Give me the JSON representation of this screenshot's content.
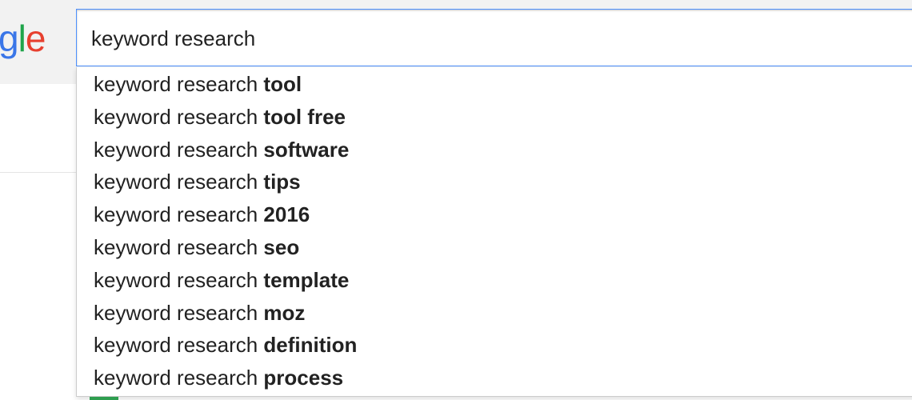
{
  "logo": {
    "letters": [
      "g",
      "l",
      "e"
    ]
  },
  "search": {
    "query": "keyword research"
  },
  "suggestions": [
    {
      "prefix": "keyword research ",
      "completion": "tool"
    },
    {
      "prefix": "keyword research ",
      "completion": "tool free"
    },
    {
      "prefix": "keyword research ",
      "completion": "software"
    },
    {
      "prefix": "keyword research ",
      "completion": "tips"
    },
    {
      "prefix": "keyword research ",
      "completion": "2016"
    },
    {
      "prefix": "keyword research ",
      "completion": "seo"
    },
    {
      "prefix": "keyword research ",
      "completion": "template"
    },
    {
      "prefix": "keyword research ",
      "completion": "moz"
    },
    {
      "prefix": "keyword research ",
      "completion": "definition"
    },
    {
      "prefix": "keyword research ",
      "completion": "process"
    }
  ],
  "colors": {
    "logo_blue": "#3a76e8",
    "logo_green": "#1fa44a",
    "logo_red": "#e7402f",
    "focus_border": "#4d90fe",
    "header_bg": "#f2f2f2"
  },
  "icons": {
    "mic": "microphone-icon"
  }
}
